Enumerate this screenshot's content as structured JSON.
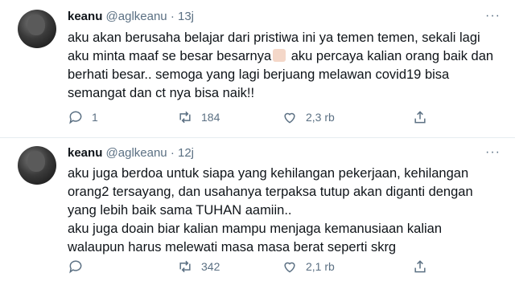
{
  "tweets": [
    {
      "name": "keanu",
      "handle": "@aglkeanu",
      "dot": "·",
      "time": "13j",
      "text_a": "aku akan berusaha belajar dari pristiwa ini ya temen temen, sekali lagi aku minta maaf se besar besarnya",
      "emoji": "pray-emoji",
      "text_b": " aku percaya kalian orang baik dan berhati besar.. semoga yang lagi berjuang melawan covid19 bisa semangat dan ct nya bisa naik!!",
      "replies": "1",
      "retweets": "184",
      "likes": "2,3 rb"
    },
    {
      "name": "keanu",
      "handle": "@aglkeanu",
      "dot": "·",
      "time": "12j",
      "text_a": "aku juga berdoa untuk siapa yang kehilangan pekerjaan, kehilangan orang2 tersayang, dan usahanya terpaksa tutup akan diganti dengan yang lebih baik sama TUHAN aamiin..",
      "text_b": "aku juga doain biar kalian mampu menjaga kemanusiaan kalian walaupun harus melewati masa masa berat seperti skrg",
      "replies": "",
      "retweets": "342",
      "likes": "2,1 rb"
    }
  ],
  "more_glyph": "···",
  "colors": {
    "text": "#0f1419",
    "muted": "#5b7083",
    "divider": "#e6ecf0"
  }
}
